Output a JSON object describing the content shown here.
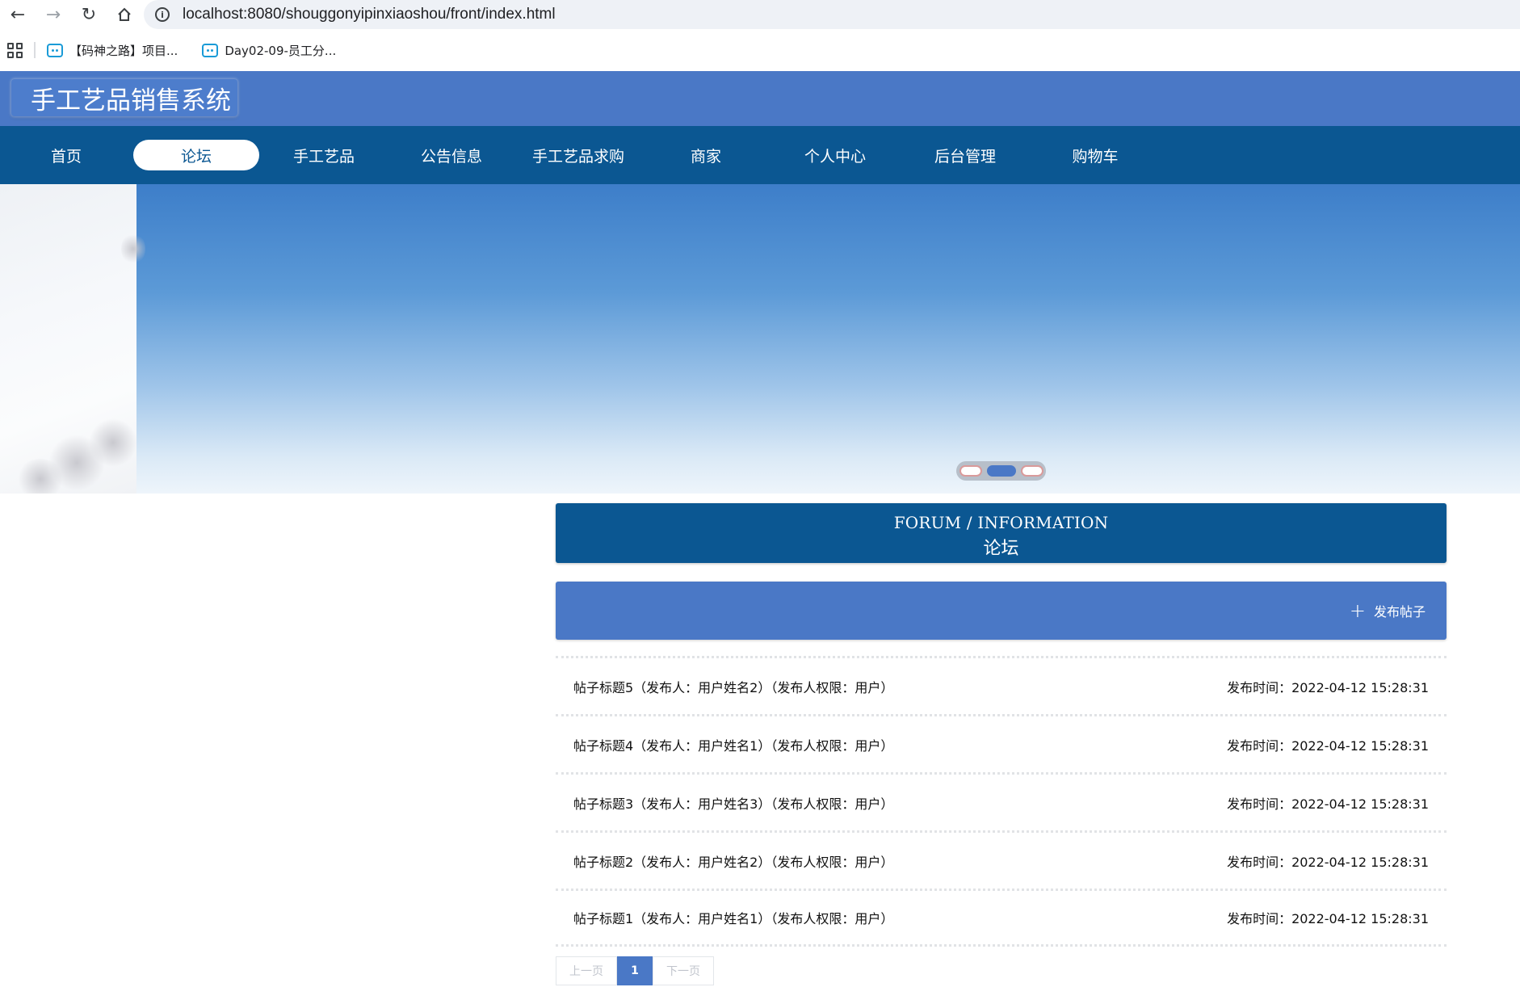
{
  "browser": {
    "url": "localhost:8080/shouggonyipinxiaoshou/front/index.html",
    "bookmarks": [
      {
        "label": "【码神之路】项目..."
      },
      {
        "label": "Day02-09-员工分..."
      }
    ]
  },
  "site": {
    "title": "手工艺品销售系统"
  },
  "nav": {
    "items": [
      {
        "label": "首页"
      },
      {
        "label": "论坛"
      },
      {
        "label": "手工艺品"
      },
      {
        "label": "公告信息"
      },
      {
        "label": "手工艺品求购"
      },
      {
        "label": "商家"
      },
      {
        "label": "个人中心"
      },
      {
        "label": "后台管理"
      },
      {
        "label": "购物车"
      }
    ],
    "active_index": 1
  },
  "carousel": {
    "slide_count": 3,
    "active_index": 1
  },
  "forum": {
    "title_en": "FORUM / INFORMATION",
    "title_cn": "论坛",
    "publish_label": "发布帖子",
    "posts": [
      {
        "title": "帖子标题5（发布人：用户姓名2）（发布人权限：用户）",
        "time": "发布时间：2022-04-12 15:28:31"
      },
      {
        "title": "帖子标题4（发布人：用户姓名1）（发布人权限：用户）",
        "time": "发布时间：2022-04-12 15:28:31"
      },
      {
        "title": "帖子标题3（发布人：用户姓名3）（发布人权限：用户）",
        "time": "发布时间：2022-04-12 15:28:31"
      },
      {
        "title": "帖子标题2（发布人：用户姓名2）（发布人权限：用户）",
        "time": "发布时间：2022-04-12 15:28:31"
      },
      {
        "title": "帖子标题1（发布人：用户姓名1）（发布人权限：用户）",
        "time": "发布时间：2022-04-12 15:28:31"
      }
    ]
  },
  "pagination": {
    "prev_label": "上一页",
    "current_page": "1",
    "next_label": "下一页"
  },
  "colors": {
    "header_blue": "#4a78c6",
    "nav_dark_blue": "#0b5792"
  }
}
